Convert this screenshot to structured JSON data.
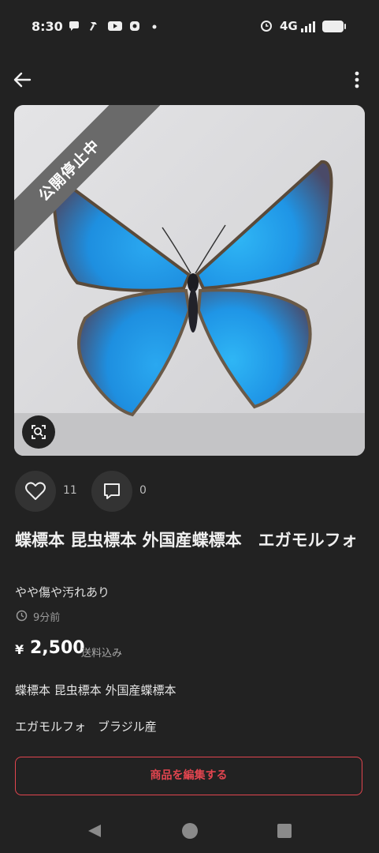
{
  "status_bar": {
    "time": "8:30",
    "network": "4G",
    "icons": [
      "chat-bubble-icon",
      "hammer-icon",
      "youtube-icon",
      "app-icon",
      "dot-icon",
      "alarm-icon",
      "signal-icon",
      "battery-icon"
    ]
  },
  "app_bar": {
    "back_icon": "arrow-left-icon",
    "menu_icon": "more-vertical-icon"
  },
  "product_image": {
    "ribbon": "公開停止中",
    "lens_icon": "image-search-icon"
  },
  "actions": {
    "likes": "11",
    "comments": "0"
  },
  "product": {
    "title": "蝶標本 昆虫標本 外国産蝶標本　エガモルフォ",
    "condition": "やや傷や汚れあり",
    "posted": "9分前",
    "price_symbol": "¥",
    "price": "2,500",
    "shipping": "送料込み",
    "description_line1": "蝶標本 昆虫標本 外国産蝶標本",
    "description_line2": "エガモルフォ　ブラジル産"
  },
  "edit_button": "商品を編集する",
  "colors": {
    "background": "#222222",
    "accent": "#e2454f"
  }
}
